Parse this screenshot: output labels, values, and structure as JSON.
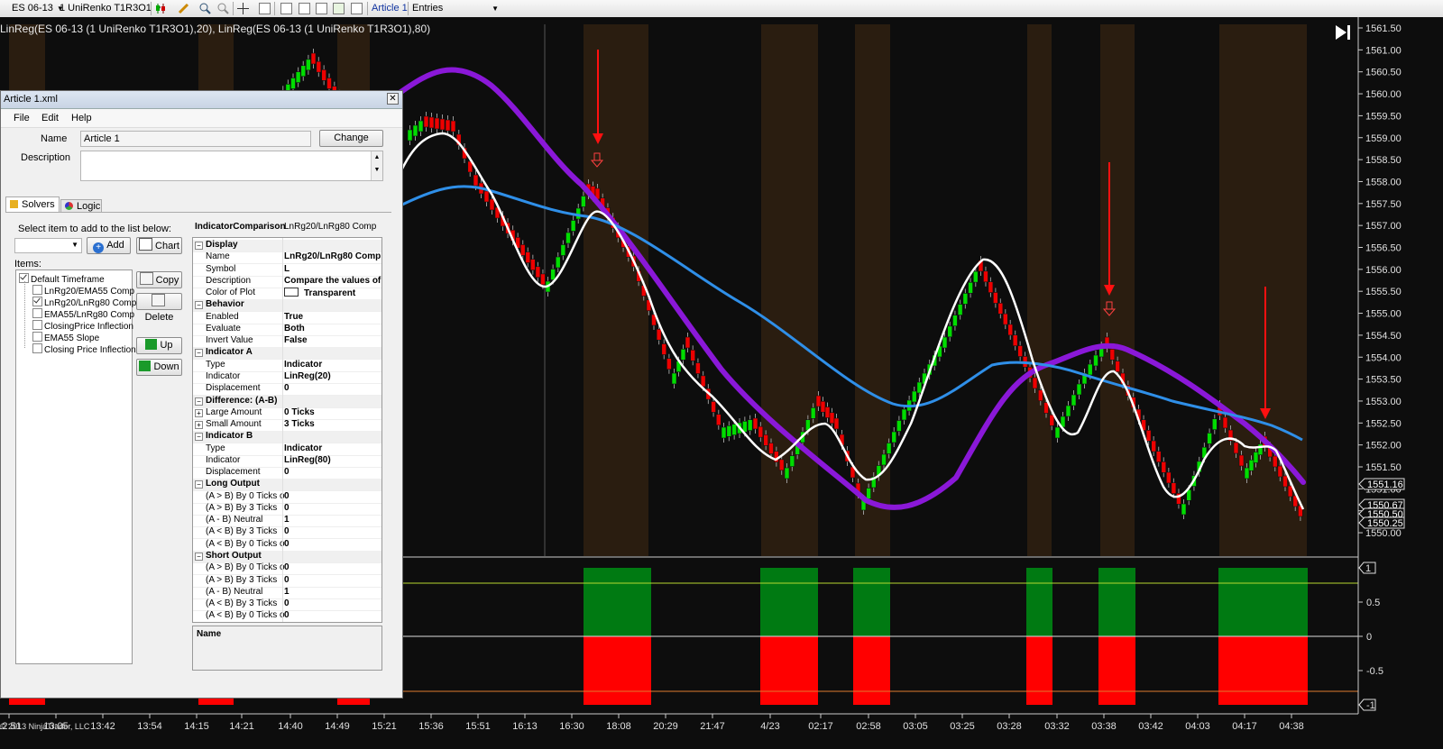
{
  "toolbar": {
    "instrument": "ES 06-13",
    "bar_type": "1 UniRenko T1R3O1",
    "workspace": "Article 1",
    "entries": "Entries"
  },
  "chart": {
    "plot_label": "LinReg(ES 06-13 (1 UniRenko T1R3O1),20), LinReg(ES 06-13 (1 UniRenko T1R3O1),80)",
    "copyright": "© 2013 NinjaTrader, LLC",
    "price_axis": [
      "1561.50",
      "1561.00",
      "1560.50",
      "1560.00",
      "1559.50",
      "1559.00",
      "1558.50",
      "1558.00",
      "1557.50",
      "1557.00",
      "1556.50",
      "1556.00",
      "1555.50",
      "1555.00",
      "1554.50",
      "1554.00",
      "1553.50",
      "1553.00",
      "1552.50",
      "1552.00",
      "1551.50",
      "1551.00",
      "1550.50",
      "1550.00"
    ],
    "price_labels": [
      "1551.16",
      "1550.67",
      "1550.50",
      "1550.25"
    ],
    "indicator_axis": [
      "1",
      "0.5",
      "0",
      "-0.5",
      "-1"
    ],
    "time_axis": [
      "12:51",
      "13:05",
      "13:42",
      "13:54",
      "14:15",
      "14:21",
      "14:40",
      "14:49",
      "15:21",
      "15:36",
      "15:51",
      "16:13",
      "16:30",
      "18:08",
      "20:29",
      "21:47",
      "4/23",
      "02:17",
      "02:58",
      "03:05",
      "03:25",
      "03:28",
      "03:32",
      "03:38",
      "03:42",
      "04:03",
      "04:17",
      "04:38"
    ],
    "colors": {
      "up_bar": "#00dd00",
      "down_bar": "#ee0000",
      "linreg20": "#ffffff",
      "linreg80": "#8a18d8",
      "blue_line": "#2f8fe8",
      "shade": "#2a1d10",
      "long": "#007a12",
      "short": "#ff0000",
      "arrow": "#ff1010"
    }
  },
  "dialog": {
    "title": "Article 1.xml",
    "menu": [
      "File",
      "Edit",
      "Help"
    ],
    "name_label": "Name",
    "name_value": "Article 1",
    "change_button": "Change",
    "description_label": "Description",
    "tabs": [
      "Solvers",
      "Logic"
    ],
    "select_hint": "Select item to add to the list below:",
    "add_button": "Add",
    "chart_button": "Chart",
    "items_label": "Items:",
    "copy_button": "Copy",
    "delete_button": "Delete",
    "up_button": "Up",
    "down_button": "Down",
    "tree": [
      "Default Timeframe",
      "LnRg20/EMA55 Comp",
      "LnRg20/LnRg80 Comp",
      "EMA55/LnRg80 Comp",
      "ClosingPrice Inflection",
      "EMA55 Slope",
      "Closing Price Inflection"
    ],
    "props_header": "IndicatorComparison",
    "props_header_value": "LnRg20/LnRg80 Comp",
    "props": [
      {
        "cat": "Display"
      },
      {
        "k": "Name",
        "v": "LnRg20/LnRg80 Comp"
      },
      {
        "k": "Symbol",
        "v": "L"
      },
      {
        "k": "Description",
        "v": "Compare the values of"
      },
      {
        "k": "Color of Plot",
        "v": "Transparent",
        "swatch": true
      },
      {
        "cat": "Behavior"
      },
      {
        "k": "Enabled",
        "v": "True"
      },
      {
        "k": "Evaluate",
        "v": "Both"
      },
      {
        "k": "Invert Value",
        "v": "False"
      },
      {
        "cat": "Indicator A"
      },
      {
        "k": "Type",
        "v": "Indicator"
      },
      {
        "k": "Indicator",
        "v": "LinReg(20)"
      },
      {
        "k": "Displacement",
        "v": "0"
      },
      {
        "cat": "Difference: (A-B)"
      },
      {
        "k": "Large Amount",
        "v": "0 Ticks",
        "pm": true
      },
      {
        "k": "Small Amount",
        "v": "3 Ticks",
        "pm": true
      },
      {
        "cat": "Indicator B"
      },
      {
        "k": "Type",
        "v": "Indicator"
      },
      {
        "k": "Indicator",
        "v": "LinReg(80)"
      },
      {
        "k": "Displacement",
        "v": "0"
      },
      {
        "cat": "Long Output"
      },
      {
        "k": "(A > B) By 0 Ticks o",
        "v": "0"
      },
      {
        "k": "(A > B) By 3 Ticks",
        "v": "0"
      },
      {
        "k": "(A - B) Neutral",
        "v": "1"
      },
      {
        "k": "(A < B) By 3 Ticks",
        "v": "0"
      },
      {
        "k": "(A < B) By 0 Ticks o",
        "v": "0"
      },
      {
        "cat": "Short Output"
      },
      {
        "k": "(A > B) By 0 Ticks o",
        "v": "0"
      },
      {
        "k": "(A > B) By 3 Ticks",
        "v": "0"
      },
      {
        "k": "(A - B) Neutral",
        "v": "1"
      },
      {
        "k": "(A < B) By 3 Ticks",
        "v": "0"
      },
      {
        "k": "(A < B) By 0 Ticks o",
        "v": "0"
      }
    ],
    "name_box_label": "Name"
  }
}
